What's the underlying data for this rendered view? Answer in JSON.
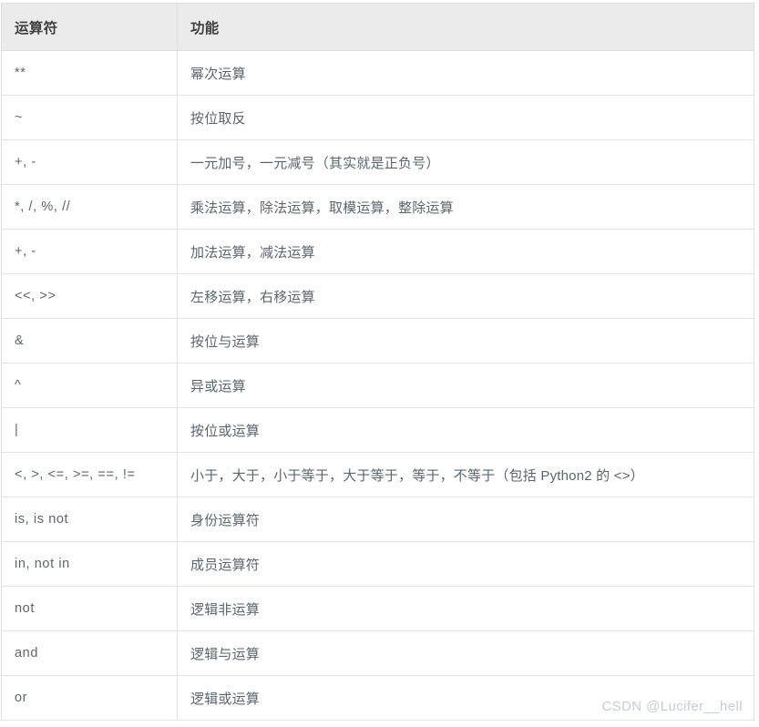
{
  "table": {
    "headers": [
      "运算符",
      "功能"
    ],
    "rows": [
      {
        "operator": "**",
        "function": "幂次运算"
      },
      {
        "operator": "~",
        "function": "按位取反"
      },
      {
        "operator": "+, -",
        "function": "一元加号，一元减号（其实就是正负号）"
      },
      {
        "operator": "*, /, %, //",
        "function": "乘法运算，除法运算，取模运算，整除运算"
      },
      {
        "operator": "+, -",
        "function": "加法运算，减法运算"
      },
      {
        "operator": "<<, >>",
        "function": "左移运算，右移运算"
      },
      {
        "operator": "&",
        "function": "按位与运算"
      },
      {
        "operator": "^",
        "function": "异或运算"
      },
      {
        "operator": "|",
        "function": "按位或运算"
      },
      {
        "operator": "<, >, <=, >=, ==, !=",
        "function": "小于，大于，小于等于，大于等于，等于，不等于（包括 Python2 的 <>）"
      },
      {
        "operator": "is, is not",
        "function": "身份运算符"
      },
      {
        "operator": "in, not in",
        "function": "成员运算符"
      },
      {
        "operator": "not",
        "function": "逻辑非运算"
      },
      {
        "operator": "and",
        "function": "逻辑与运算"
      },
      {
        "operator": "or",
        "function": "逻辑或运算"
      }
    ]
  },
  "watermark": {
    "text": "CSDN @Lucifer__hell"
  },
  "colors": {
    "header_bg": "#ebebeb",
    "header_text": "#3f3f3f",
    "body_text": "#5b6570",
    "border": "#e3e3e3",
    "watermark_text": "#c9cdd2"
  }
}
